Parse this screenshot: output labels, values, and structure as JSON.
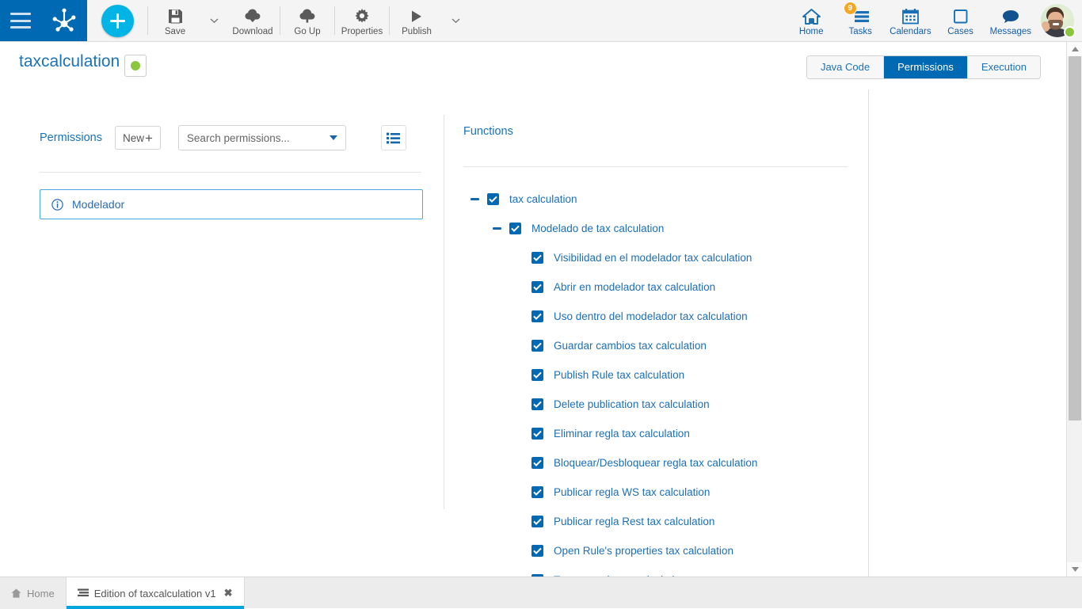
{
  "topbar": {
    "menu_icon": "hamburger-menu-icon",
    "logo_icon": "bizagi-logo-icon",
    "create_button_label": "+",
    "left_items": [
      {
        "label": "Save",
        "icon": "floppy-disk-icon",
        "has_caret": true
      },
      {
        "label": "Download",
        "icon": "cloud-download-icon",
        "has_caret": false
      },
      {
        "label": "Go Up",
        "icon": "cloud-upload-icon",
        "has_caret": false
      },
      {
        "label": "Properties",
        "icon": "gear-icon",
        "has_caret": false
      },
      {
        "label": "Publish",
        "icon": "play-triangle-icon",
        "has_caret": true
      }
    ],
    "right_items": [
      {
        "label": "Home",
        "icon": "home-icon",
        "badge": null
      },
      {
        "label": "Tasks",
        "icon": "tasks-list-icon",
        "badge": "9"
      },
      {
        "label": "Calendars",
        "icon": "calendar-icon",
        "badge": null
      },
      {
        "label": "Cases",
        "icon": "square-outline-icon",
        "badge": null
      },
      {
        "label": "Messages",
        "icon": "speech-bubble-icon",
        "badge": null
      }
    ],
    "avatar": {
      "icon": "user-avatar",
      "status": "online"
    }
  },
  "header": {
    "title": "taxcalculation",
    "state_icon": "green-status-dot",
    "tabs": [
      {
        "label": "Java Code",
        "active": false
      },
      {
        "label": "Permissions",
        "active": true
      },
      {
        "label": "Execution",
        "active": false
      }
    ]
  },
  "left_panel": {
    "section_label": "Permissions",
    "new_button_label": "New",
    "new_button_plus": "+",
    "search": {
      "value": "Search permissions...",
      "placeholder": "Search permissions..."
    },
    "list_view_icon": "list-view-icon",
    "permissions": [
      {
        "label": "Modelador",
        "icon": "info-circle-icon",
        "selected": true
      }
    ]
  },
  "right_panel": {
    "section_label": "Functions",
    "tree": [
      {
        "label": "tax calculation",
        "level": 0,
        "checked": true,
        "expandable": true,
        "expanded": true
      },
      {
        "label": "Modelado de tax calculation",
        "level": 1,
        "checked": true,
        "expandable": true,
        "expanded": true
      },
      {
        "label": "Visibilidad en el modelador tax calculation",
        "level": 2,
        "checked": true,
        "expandable": false,
        "expanded": false
      },
      {
        "label": "Abrir en modelador tax calculation",
        "level": 2,
        "checked": true,
        "expandable": false,
        "expanded": false
      },
      {
        "label": "Uso dentro del modelador tax calculation",
        "level": 2,
        "checked": true,
        "expandable": false,
        "expanded": false
      },
      {
        "label": "Guardar cambios tax calculation",
        "level": 2,
        "checked": true,
        "expandable": false,
        "expanded": false
      },
      {
        "label": "Publish Rule tax calculation",
        "level": 2,
        "checked": true,
        "expandable": false,
        "expanded": false
      },
      {
        "label": "Delete publication tax calculation",
        "level": 2,
        "checked": true,
        "expandable": false,
        "expanded": false
      },
      {
        "label": "Eliminar regla tax calculation",
        "level": 2,
        "checked": true,
        "expandable": false,
        "expanded": false
      },
      {
        "label": "Bloquear/Desbloquear regla tax calculation",
        "level": 2,
        "checked": true,
        "expandable": false,
        "expanded": false
      },
      {
        "label": "Publicar regla WS tax calculation",
        "level": 2,
        "checked": true,
        "expandable": false,
        "expanded": false
      },
      {
        "label": "Publicar regla Rest tax calculation",
        "level": 2,
        "checked": true,
        "expandable": false,
        "expanded": false
      },
      {
        "label": "Open Rule's properties tax calculation",
        "level": 2,
        "checked": true,
        "expandable": false,
        "expanded": false
      },
      {
        "label": "Testear regla tax calculation",
        "level": 2,
        "checked": true,
        "expandable": false,
        "expanded": false
      }
    ]
  },
  "bottom_tabs": [
    {
      "label": "Home",
      "icon": "home-small-icon",
      "active": false,
      "closable": false
    },
    {
      "label": "Edition of taxcalculation v1",
      "icon": "document-lines-icon",
      "active": true,
      "closable": true,
      "close_glyph": "✖"
    }
  ],
  "scrollbar": {
    "up_icon": "scroll-up-arrow",
    "down_icon": "scroll-down-arrow"
  },
  "colors": {
    "brand_blue": "#0069b4",
    "accent_cyan": "#00b4e5",
    "link_blue": "#1d6fb8",
    "status_green": "#8cc63f",
    "badge_orange": "#f5a623"
  }
}
